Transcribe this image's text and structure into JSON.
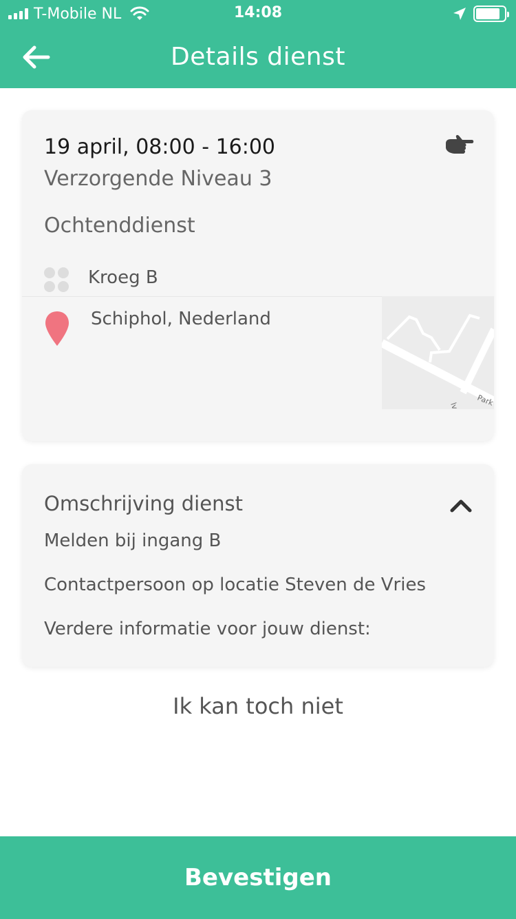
{
  "status_bar": {
    "carrier": "T-Mobile NL",
    "time": "14:08",
    "battery_level": 0.85
  },
  "header": {
    "title": "Details dienst",
    "back_icon": "arrow-left-icon"
  },
  "shift_card": {
    "date_time": "19 april, 08:00 - 16:00",
    "role": "Verzorgende Niveau 3",
    "shift_name": "Ochtenddienst",
    "department": "Kroeg B",
    "location": "Schiphol, Nederland",
    "map_labels": [
      "Park",
      "lvd"
    ],
    "action_icon": "pointing-hand-icon"
  },
  "description_card": {
    "title": "Omschrijving dienst",
    "lines": [
      "Melden bij ingang B",
      "Contactpersoon op locatie Steven de Vries",
      "Verdere informatie voor jouw dienst:"
    ],
    "toggle_icon": "chevron-up-icon"
  },
  "actions": {
    "cancel_label": "Ik kan toch niet",
    "confirm_label": "Bevestigen"
  },
  "colors": {
    "brand": "#3dbf98",
    "pin": "#f07480",
    "card_bg": "#f5f5f5"
  }
}
